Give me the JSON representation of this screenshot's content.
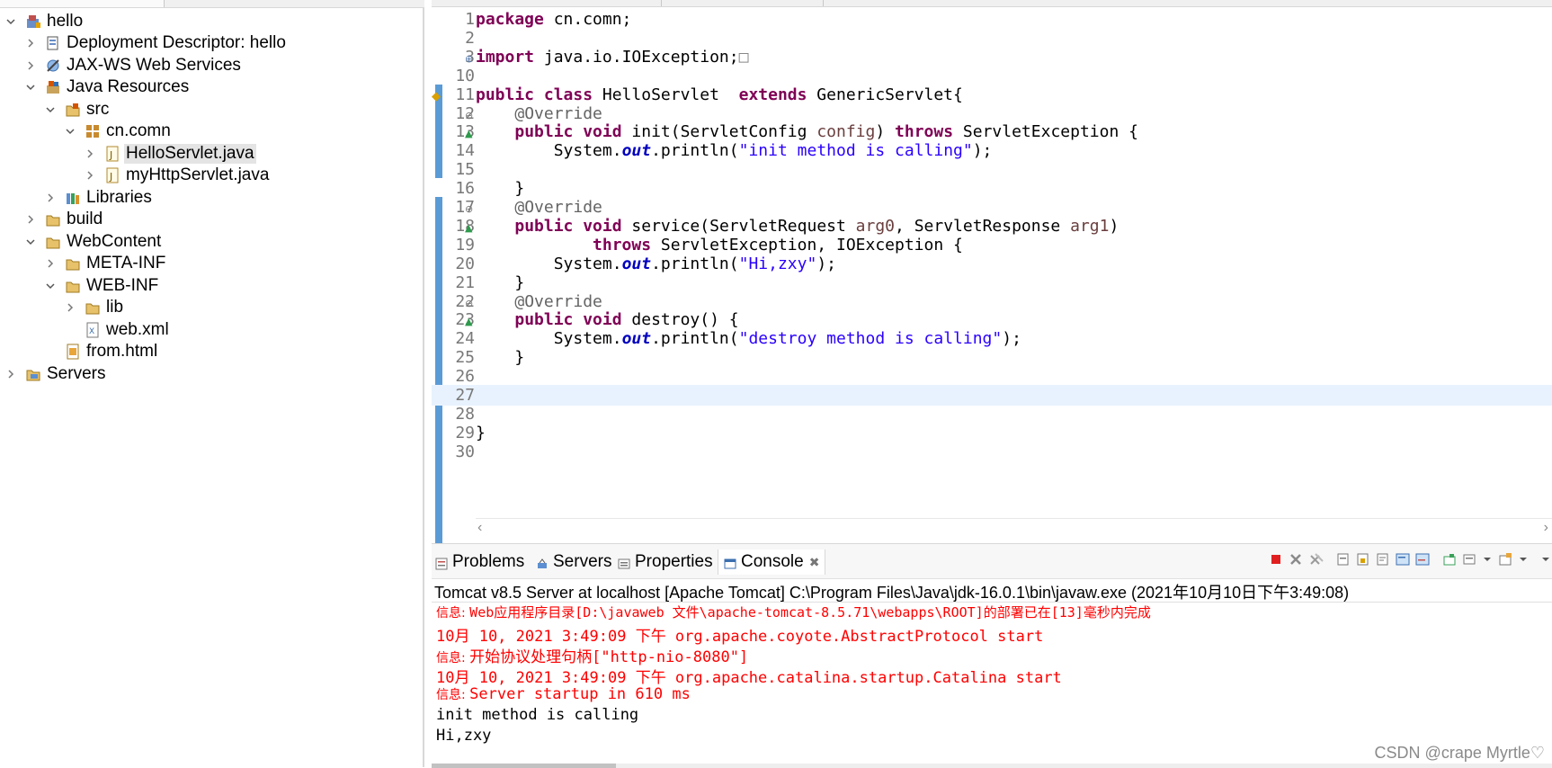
{
  "explorer": {
    "items": [
      {
        "label": "hello",
        "depth": 0,
        "expanded": true,
        "icon": "project-icon"
      },
      {
        "label": "Deployment Descriptor: hello",
        "depth": 1,
        "expanded": false,
        "icon": "deployment-descriptor-icon"
      },
      {
        "label": "JAX-WS Web Services",
        "depth": 1,
        "expanded": false,
        "icon": "webservices-icon"
      },
      {
        "label": "Java Resources",
        "depth": 1,
        "expanded": true,
        "icon": "java-resources-icon"
      },
      {
        "label": "src",
        "depth": 2,
        "expanded": true,
        "icon": "source-folder-icon"
      },
      {
        "label": "cn.comn",
        "depth": 3,
        "expanded": true,
        "icon": "package-icon"
      },
      {
        "label": "HelloServlet.java",
        "depth": 4,
        "expanded": false,
        "icon": "java-file-icon",
        "selected": true
      },
      {
        "label": "myHttpServlet.java",
        "depth": 4,
        "expanded": false,
        "icon": "java-file-icon"
      },
      {
        "label": "Libraries",
        "depth": 2,
        "expanded": false,
        "icon": "libraries-icon"
      },
      {
        "label": "build",
        "depth": 1,
        "expanded": false,
        "icon": "folder-icon"
      },
      {
        "label": "WebContent",
        "depth": 1,
        "expanded": true,
        "icon": "folder-icon"
      },
      {
        "label": "META-INF",
        "depth": 2,
        "expanded": false,
        "icon": "folder-icon"
      },
      {
        "label": "WEB-INF",
        "depth": 2,
        "expanded": true,
        "icon": "folder-icon"
      },
      {
        "label": "lib",
        "depth": 3,
        "expanded": false,
        "icon": "folder-icon"
      },
      {
        "label": "web.xml",
        "depth": 3,
        "leaf": true,
        "icon": "xml-file-icon"
      },
      {
        "label": "from.html",
        "depth": 2,
        "leaf": true,
        "icon": "html-file-icon"
      },
      {
        "label": "Servers",
        "depth": 0,
        "expanded": false,
        "icon": "servers-folder-icon"
      }
    ]
  },
  "editor": {
    "lines": [
      {
        "n": "1",
        "t": [
          [
            "kw",
            "package"
          ],
          [
            "p",
            " cn.comn;"
          ]
        ]
      },
      {
        "n": "2",
        "t": []
      },
      {
        "n": "3",
        "m": "fold-plus",
        "t": [
          [
            "kw",
            "import"
          ],
          [
            "p",
            " java.io.IOException;"
          ],
          [
            "box",
            "□"
          ]
        ]
      },
      {
        "n": "10",
        "t": []
      },
      {
        "n": "11",
        "m": "warning",
        "t": [
          [
            "kw",
            "public class"
          ],
          [
            "p",
            " HelloServlet  "
          ],
          [
            "kw",
            "extends"
          ],
          [
            "p",
            " GenericServlet{"
          ]
        ]
      },
      {
        "n": "12",
        "m": "fold-minus",
        "t": [
          [
            "p",
            "    "
          ],
          [
            "ann",
            "@Override"
          ]
        ]
      },
      {
        "n": "13",
        "m": "override",
        "t": [
          [
            "p",
            "    "
          ],
          [
            "kw",
            "public void"
          ],
          [
            "p",
            " init(ServletConfig "
          ],
          [
            "param",
            "config"
          ],
          [
            "p",
            ") "
          ],
          [
            "kw",
            "throws"
          ],
          [
            "p",
            " ServletException {"
          ]
        ]
      },
      {
        "n": "14",
        "t": [
          [
            "p",
            "        System."
          ],
          [
            "fld",
            "out"
          ],
          [
            "p",
            ".println("
          ],
          [
            "str",
            "\"init method is calling\""
          ],
          [
            "p",
            ");"
          ]
        ]
      },
      {
        "n": "15",
        "t": []
      },
      {
        "n": "16",
        "t": [
          [
            "p",
            "    }"
          ]
        ]
      },
      {
        "n": "17",
        "m": "fold-minus",
        "t": [
          [
            "p",
            "    "
          ],
          [
            "ann",
            "@Override"
          ]
        ]
      },
      {
        "n": "18",
        "m": "override",
        "t": [
          [
            "p",
            "    "
          ],
          [
            "kw",
            "public void"
          ],
          [
            "p",
            " service(ServletRequest "
          ],
          [
            "param",
            "arg0"
          ],
          [
            "p",
            ", ServletResponse "
          ],
          [
            "param",
            "arg1"
          ],
          [
            "p",
            ")"
          ]
        ]
      },
      {
        "n": "19",
        "t": [
          [
            "p",
            "            "
          ],
          [
            "kw",
            "throws"
          ],
          [
            "p",
            " ServletException, IOException {"
          ]
        ]
      },
      {
        "n": "20",
        "t": [
          [
            "p",
            "        System."
          ],
          [
            "fld",
            "out"
          ],
          [
            "p",
            ".println("
          ],
          [
            "str",
            "\"Hi,zxy\""
          ],
          [
            "p",
            ");"
          ]
        ]
      },
      {
        "n": "21",
        "t": [
          [
            "p",
            "    }"
          ]
        ]
      },
      {
        "n": "22",
        "m": "fold-minus",
        "t": [
          [
            "p",
            "    "
          ],
          [
            "ann",
            "@Override"
          ]
        ]
      },
      {
        "n": "23",
        "m": "override",
        "t": [
          [
            "p",
            "    "
          ],
          [
            "kw",
            "public void"
          ],
          [
            "p",
            " destroy() {"
          ]
        ]
      },
      {
        "n": "24",
        "t": [
          [
            "p",
            "        System."
          ],
          [
            "fld",
            "out"
          ],
          [
            "p",
            ".println("
          ],
          [
            "str",
            "\"destroy method is calling\""
          ],
          [
            "p",
            ");"
          ]
        ]
      },
      {
        "n": "25",
        "t": [
          [
            "p",
            "    }"
          ]
        ]
      },
      {
        "n": "26",
        "t": []
      },
      {
        "n": "27",
        "current": true,
        "t": []
      },
      {
        "n": "28",
        "t": []
      },
      {
        "n": "29",
        "t": [
          [
            "p",
            "}"
          ]
        ]
      },
      {
        "n": "30",
        "t": []
      }
    ]
  },
  "panel": {
    "tabs": [
      {
        "label": "Problems",
        "icon": "problems-icon"
      },
      {
        "label": "Servers",
        "icon": "servers-icon"
      },
      {
        "label": "Properties",
        "icon": "properties-icon"
      },
      {
        "label": "Console",
        "icon": "console-icon",
        "active": true
      }
    ],
    "console_title": "Tomcat v8.5 Server at localhost [Apache Tomcat] C:\\Program Files\\Java\\jdk-16.0.1\\bin\\javaw.exe  (2021年10月10日下午3:49:08)",
    "console_lines": [
      {
        "prefix": "信息: ",
        "text": "Web应用程序目录[D:\\javaweb 文件\\apache-tomcat-8.5.71\\webapps\\ROOT]的部署已在[13]毫秒内完成",
        "small": true
      },
      {
        "text": "10月 10, 2021 3:49:09 下午 org.apache.coyote.AbstractProtocol start"
      },
      {
        "prefix": "信息: ",
        "text": "开始协议处理句柄[\"http-nio-8080\"]"
      },
      {
        "text": "10月 10, 2021 3:49:09 下午 org.apache.catalina.startup.Catalina start"
      },
      {
        "prefix": "信息: ",
        "text": "Server startup in 610 ms"
      },
      {
        "text": "init method is calling",
        "black": true
      },
      {
        "text": "Hi,zxy",
        "black": true
      }
    ],
    "watermark": "CSDN @crape Myrtle♡"
  },
  "colors": {
    "keyword": "#7f0055",
    "string": "#2a00ff",
    "annotation": "#646464",
    "field": "#0000c0",
    "param": "#6a3e3e",
    "console_error": "#ff0000",
    "current_line": "#e8f2fe"
  }
}
